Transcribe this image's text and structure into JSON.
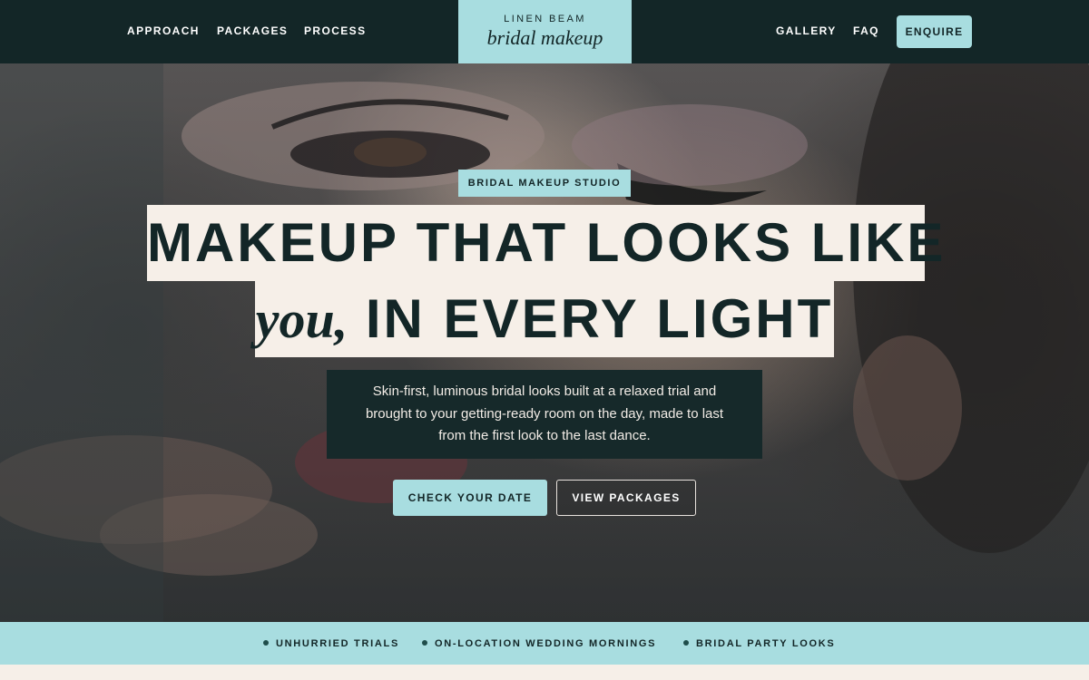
{
  "header": {
    "nav_left": [
      "APPROACH",
      "PACKAGES",
      "PROCESS"
    ],
    "nav_right": [
      "GALLERY",
      "FAQ"
    ],
    "logo_top": "LINEN BEAM",
    "logo_bottom": "bridal makeup",
    "cta": "ENQUIRE"
  },
  "hero": {
    "eyebrow": "BRIDAL MAKEUP STUDIO",
    "headline_line1": "MAKEUP THAT LOOKS LIKE",
    "headline_accent": "you,",
    "headline_line2_rest": " IN EVERY LIGHT",
    "lede": "Skin-first, luminous bridal looks built at a relaxed trial and brought to your getting-ready room on the day, made to last from the first look to the last dance.",
    "primary_button": "CHECK YOUR DATE",
    "secondary_button": "VIEW PACKAGES"
  },
  "features": [
    "UNHURRIED TRIALS",
    "ON-LOCATION WEDDING MORNINGS",
    "BRIDAL PARTY LOOKS"
  ],
  "colors": {
    "navy": "#132627",
    "aqua": "#a8dde0",
    "cream": "#f6efe8",
    "lede_bg": "#16292a"
  }
}
